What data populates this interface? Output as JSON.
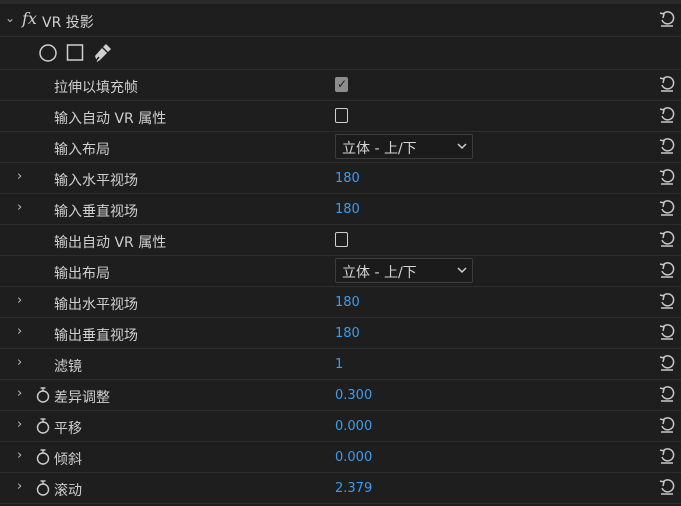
{
  "effect": {
    "fx_symbol": "fx",
    "title": "VR 投影",
    "tools": [
      "ellipse-mask-icon",
      "rectangle-mask-icon",
      "pen-mask-icon"
    ]
  },
  "properties": [
    {
      "label": "拉伸以填充帧",
      "type": "checkbox",
      "checked": true
    },
    {
      "label": "输入自动 VR 属性",
      "type": "checkbox",
      "checked": false
    },
    {
      "label": "输入布局",
      "type": "dropdown",
      "value": "立体 - 上/下"
    },
    {
      "label": "输入水平视场",
      "type": "number",
      "value": "180",
      "expandable": true
    },
    {
      "label": "输入垂直视场",
      "type": "number",
      "value": "180",
      "expandable": true
    },
    {
      "label": "输出自动 VR 属性",
      "type": "checkbox",
      "checked": false
    },
    {
      "label": "输出布局",
      "type": "dropdown",
      "value": "立体 - 上/下"
    },
    {
      "label": "输出水平视场",
      "type": "number",
      "value": "180",
      "expandable": true
    },
    {
      "label": "输出垂直视场",
      "type": "number",
      "value": "180",
      "expandable": true
    },
    {
      "label": "滤镜",
      "type": "number",
      "value": "1",
      "expandable": true
    },
    {
      "label": "差异调整",
      "type": "number",
      "value": "0.300",
      "expandable": true,
      "stopwatch": true
    },
    {
      "label": "平移",
      "type": "number",
      "value": "0.000",
      "expandable": true,
      "stopwatch": true
    },
    {
      "label": "倾斜",
      "type": "number",
      "value": "0.000",
      "expandable": true,
      "stopwatch": true
    },
    {
      "label": "滚动",
      "type": "number",
      "value": "2.379",
      "expandable": true,
      "stopwatch": true
    }
  ],
  "colors": {
    "value_blue": "#3b9cf0",
    "background": "#1e1e1e"
  },
  "icons": {
    "reset": "reset-icon",
    "expand": "chevron-right-icon",
    "collapse": "chevron-down-icon",
    "stopwatch": "stopwatch-icon"
  }
}
